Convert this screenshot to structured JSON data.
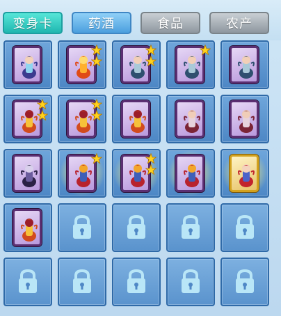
{
  "tabs": [
    {
      "label": "变身卡",
      "state": "active"
    },
    {
      "label": "药酒",
      "state": "normal"
    },
    {
      "label": "食品",
      "state": "disabled"
    },
    {
      "label": "农产",
      "state": "disabled"
    }
  ],
  "colors": {
    "slot": "#4d87c5",
    "card_border": "#5b2f72",
    "gold_border": "#d3a21e",
    "star": "#ffd21e",
    "lock": "#b9e6f7"
  },
  "grid": {
    "rows": [
      [
        {
          "type": "card",
          "figure": "fairy-girl",
          "stars": 0
        },
        {
          "type": "card",
          "figure": "fire-phoenix",
          "stars": 2
        },
        {
          "type": "card",
          "figure": "archer-girl",
          "stars": 2
        },
        {
          "type": "card",
          "figure": "archer-girl",
          "stars": 1
        },
        {
          "type": "card",
          "figure": "archer-girl",
          "stars": 0
        }
      ],
      [
        {
          "type": "card",
          "figure": "golden-lion",
          "stars": 2
        },
        {
          "type": "card",
          "figure": "golden-lion",
          "stars": 2
        },
        {
          "type": "card",
          "figure": "golden-lion",
          "stars": 0
        },
        {
          "type": "card",
          "figure": "winged-dancer",
          "stars": 0
        },
        {
          "type": "card",
          "figure": "winged-dancer",
          "stars": 0
        }
      ],
      [
        {
          "type": "card",
          "figure": "dark-warrior",
          "stars": 0
        },
        {
          "type": "card",
          "figure": "red-bird",
          "stars": 1,
          "glow": true
        },
        {
          "type": "card",
          "figure": "red-bird",
          "stars": 2,
          "glow": true
        },
        {
          "type": "card",
          "figure": "red-bird",
          "stars": 0,
          "glow": true
        },
        {
          "type": "card",
          "figure": "red-hair-mage",
          "stars": 0,
          "gold": true,
          "glow": true
        }
      ],
      [
        {
          "type": "card",
          "figure": "golden-lion",
          "stars": 0
        },
        {
          "type": "locked"
        },
        {
          "type": "locked"
        },
        {
          "type": "locked"
        },
        {
          "type": "locked"
        }
      ],
      [
        {
          "type": "locked"
        },
        {
          "type": "locked"
        },
        {
          "type": "locked"
        },
        {
          "type": "locked"
        },
        {
          "type": "locked"
        }
      ]
    ]
  }
}
